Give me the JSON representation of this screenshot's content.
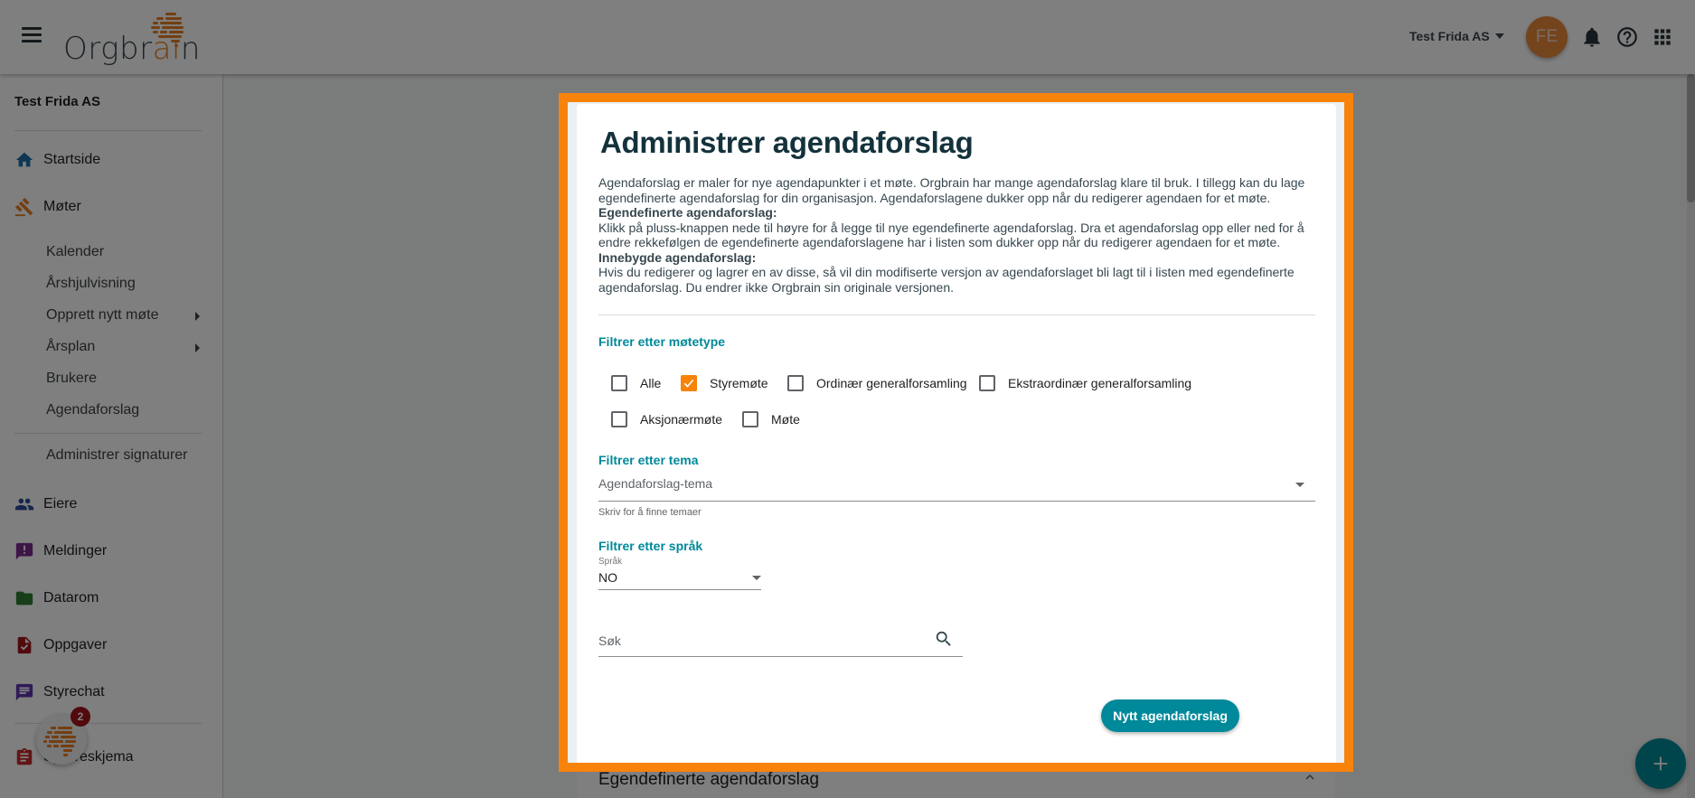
{
  "header": {
    "logo_text_main": "Orgbr",
    "logo_text_accent": "ai",
    "logo_text_end": "n",
    "org_selector": "Test Frida AS",
    "avatar_initials": "FE",
    "icons": [
      "menu-icon",
      "bell-icon",
      "help-icon",
      "apps-grid-icon"
    ]
  },
  "sidebar": {
    "org_name": "Test Frida AS",
    "items": [
      {
        "label": "Startside",
        "icon": "home-icon",
        "color": "#1e6fa8"
      },
      {
        "label": "Møter",
        "icon": "gavel-icon",
        "color": "#e67e22"
      },
      {
        "label": "Eiere",
        "icon": "people-icon",
        "color": "#2c4a9a"
      },
      {
        "label": "Meldinger",
        "icon": "message-alert-icon",
        "color": "#7b2d8e"
      },
      {
        "label": "Datarom",
        "icon": "folder-icon",
        "color": "#2e7d32"
      },
      {
        "label": "Oppgaver",
        "icon": "task-file-icon",
        "color": "#a3141b"
      },
      {
        "label": "Styrechat",
        "icon": "chat-icon",
        "color": "#5e35b1"
      },
      {
        "label": "Spørreskjema",
        "icon": "clipboard-icon",
        "color": "#c62828"
      }
    ],
    "meeting_subitems": [
      {
        "label": "Kalender",
        "has_arrow": false
      },
      {
        "label": "Årshjulvisning",
        "has_arrow": false
      },
      {
        "label": "Opprett nytt møte",
        "has_arrow": true
      },
      {
        "label": "Årsplan",
        "has_arrow": true
      },
      {
        "label": "Brukere",
        "has_arrow": false
      },
      {
        "label": "Agendaforslag",
        "has_arrow": false
      }
    ],
    "extra_subitem": "Administrer signaturer",
    "chat_badge_count": "2"
  },
  "background": {
    "card_title": "Egendefinerte agendaforslag"
  },
  "modal": {
    "title": "Administrer agendaforslag",
    "description_intro": "Agendaforslag er maler for nye agendapunkter i et møte. Orgbrain har mange agendaforslag klare til bruk. I tillegg kan du lage egendefinerte agendaforslag for din organisasjon. Agendaforslagene dukker opp når du redigerer agendaen for et møte.",
    "custom_heading": "Egendefinerte agendaforslag:",
    "custom_text": "Klikk på pluss-knappen nede til høyre for å legge til nye egendefinerte agendaforslag. Dra et agendaforslag opp eller ned for å endre rekkefølgen de egendefinerte agendaforslagene har i listen som dukker opp når du redigerer agendaen for et møte.",
    "builtin_heading": "Innebygde agendaforslag:",
    "builtin_text": "Hvis du redigerer og lagrer en av disse, så vil din modifiserte versjon av agendaforslaget bli lagt til i listen med egendefinerte agendaforslag. Du endrer ikke Orgbrain sin originale versjonen.",
    "filter_meeting_type": {
      "label": "Filtrer etter møtetype",
      "options": [
        {
          "label": "Alle",
          "checked": false
        },
        {
          "label": "Styremøte",
          "checked": true
        },
        {
          "label": "Ordinær generalforsamling",
          "checked": false
        },
        {
          "label": "Ekstraordinær generalforsamling",
          "checked": false
        },
        {
          "label": "Aksjonærmøte",
          "checked": false
        },
        {
          "label": "Møte",
          "checked": false
        }
      ]
    },
    "filter_theme": {
      "label": "Filtrer etter tema",
      "placeholder": "Agendaforslag-tema",
      "helper": "Skriv for å finne temaer"
    },
    "filter_language": {
      "label": "Filtrer etter språk",
      "field_label": "Språk",
      "value": "NO"
    },
    "search": {
      "placeholder": "Søk"
    },
    "new_button": "Nytt agendaforslag"
  },
  "colors": {
    "accent_orange": "#f7830a",
    "teal": "#00899a",
    "title_dark": "#14323c"
  }
}
